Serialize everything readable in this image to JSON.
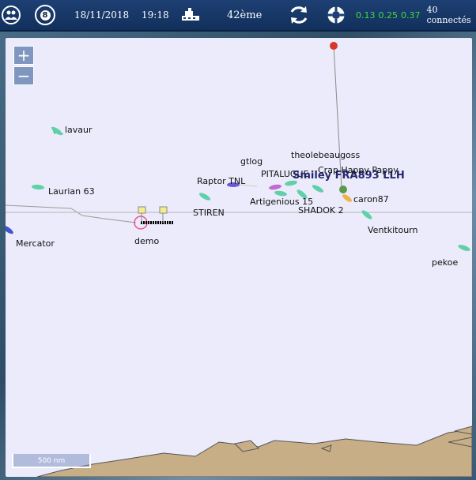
{
  "topbar": {
    "date": "18/11/2018",
    "time": "19:18",
    "rank": "42ème",
    "badge_count": "8",
    "stats": [
      "0.13",
      "0.25",
      "0.37"
    ],
    "connected": "40 connectés",
    "icons": [
      "users-icon",
      "race-wheel-icon",
      "sailboat-icon",
      "refresh-icon",
      "lifebuoy-icon"
    ]
  },
  "map": {
    "zoom_in": "+",
    "zoom_out": "−",
    "scale_label": "500 nm",
    "colors": {
      "boat": "#5fd1a9",
      "land": "#c8ae87",
      "track": "#999999"
    },
    "boats": [
      {
        "name": "lavaur"
      },
      {
        "name": "Laurian 63"
      },
      {
        "name": "Mercator"
      },
      {
        "name": "demo"
      },
      {
        "name": "STIREN"
      },
      {
        "name": "Raptor TNL"
      },
      {
        "name": "gtlog"
      },
      {
        "name": "PITALUGUE"
      },
      {
        "name": "Artigenious 15"
      },
      {
        "name": "theolebeaugoss"
      },
      {
        "name": "Smiley FRA893 LLH"
      },
      {
        "name": "Crap Happy Pappy"
      },
      {
        "name": "SHADOK 2"
      },
      {
        "name": "caron87"
      },
      {
        "name": "Ventkitourn"
      },
      {
        "name": "pekoe"
      }
    ]
  }
}
